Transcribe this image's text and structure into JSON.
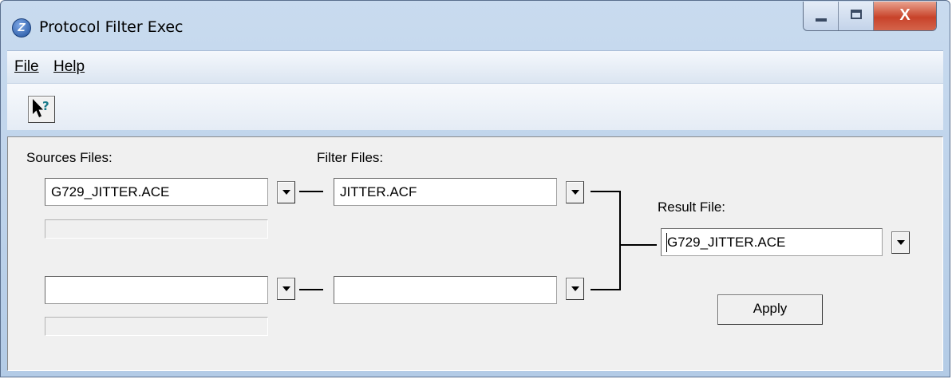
{
  "window": {
    "title": "Protocol Filter Exec",
    "app_icon_glyph": "Z",
    "close_glyph": "X"
  },
  "menu": {
    "items": [
      {
        "label": "File"
      },
      {
        "label": "Help"
      }
    ]
  },
  "toolbar": {
    "help_icon": "context-help-icon"
  },
  "labels": {
    "sources": "Sources Files:",
    "filters": "Filter Files:",
    "result": "Result File:"
  },
  "source_files": [
    {
      "value": "G729_JITTER.ACE",
      "progress": 0
    },
    {
      "value": "",
      "progress": 0
    }
  ],
  "filter_files": [
    {
      "value": "JITTER.ACF"
    },
    {
      "value": ""
    }
  ],
  "result_file": {
    "value": "G729_JITTER.ACE"
  },
  "buttons": {
    "apply": "Apply"
  },
  "colors": {
    "close_button": "#c8432a",
    "titlebar": "#c9dbef",
    "client": "#f0f0f0"
  }
}
